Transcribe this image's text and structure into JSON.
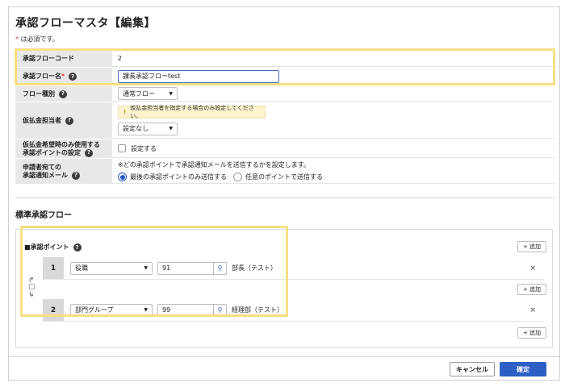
{
  "page": {
    "title": "承認フローマスタ【編集】",
    "required_star": "*",
    "required_note": "は必須です。"
  },
  "form": {
    "flow_code": {
      "label": "承認フローコード",
      "value": "2"
    },
    "flow_name": {
      "label": "承認フロー名",
      "required_star": "*",
      "value": "課長承認フローtest"
    },
    "flow_type": {
      "label": "フロー種別",
      "selected": "通常フロー"
    },
    "advance_manager": {
      "label": "仮払金担当者",
      "warning": "仮払金担当者を指定する場合のみ設定してください。",
      "selected": "設定なし"
    },
    "advance_point": {
      "label_line1": "仮払金希望時のみ使用する",
      "label_line2": "承認ポイントの設定",
      "checkbox_label": "設定する"
    },
    "notification": {
      "label_line1": "申請者宛ての",
      "label_line2": "承認通知メール",
      "description": "※どの承認ポイントで承認通知メールを送信するかを設定します。",
      "option1": "最後の承認ポイントのみ送信する",
      "option2": "任意のポイントで送信する"
    }
  },
  "standard_flow": {
    "title": "標準承認フロー",
    "point_label": "■承認ポイント",
    "add_label": "+ 追加",
    "steps": [
      {
        "number": "1",
        "type": "役職",
        "code": "91",
        "name": "部長（テスト）"
      },
      {
        "number": "2",
        "type": "部門グループ",
        "code": "99",
        "name": "経理部（テスト）"
      }
    ],
    "remove_symbol": "×"
  },
  "footer": {
    "cancel": "キャンセル",
    "confirm": "確定"
  },
  "colors": {
    "primary": "#2d5fc4",
    "highlight": "#f6df83",
    "warning_bg": "#fdf3cf",
    "required": "#e0342f"
  }
}
